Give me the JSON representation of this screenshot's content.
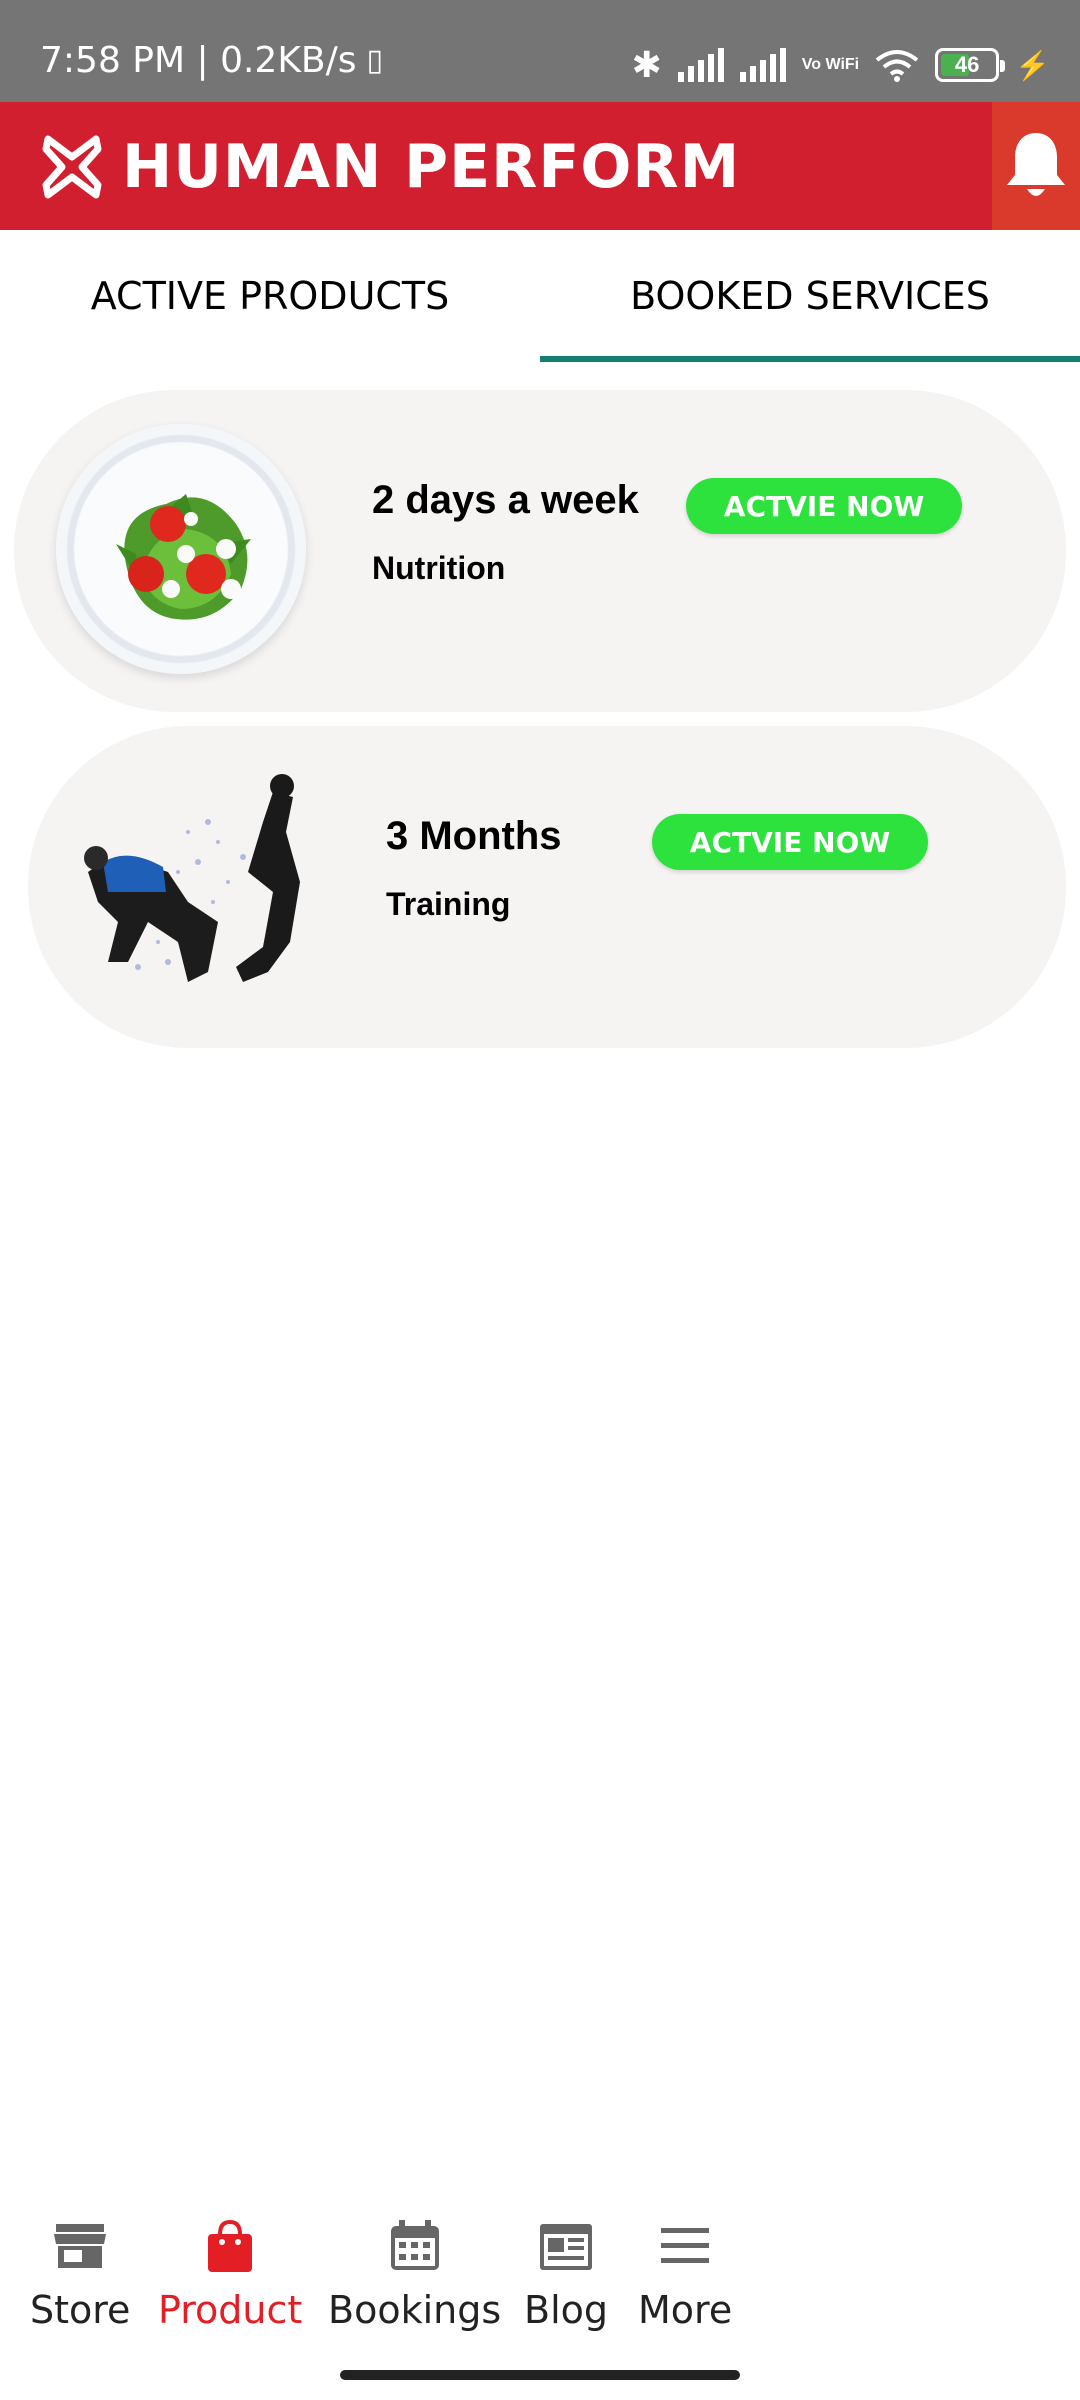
{
  "status_bar": {
    "time_speed": "7:58 PM | 0.2KB/s",
    "network_label": "Vo WiFi",
    "battery_level": "46",
    "icons": [
      "sim-icon",
      "bluetooth-icon",
      "signal-icon",
      "wifi-icon",
      "battery-icon",
      "charging-icon"
    ]
  },
  "header": {
    "brand_name": "HUMAN PERFORM",
    "brand_color": "#d21f2f",
    "notification_icon": "bell-icon"
  },
  "tabs": [
    {
      "label": "ACTIVE PRODUCTS",
      "active": false
    },
    {
      "label": "BOOKED SERVICES",
      "active": true
    }
  ],
  "tab_indicator_color": "#137f6f",
  "services": [
    {
      "title": "2 days a week",
      "category": "Nutrition",
      "button_label": "ACTVIE NOW",
      "image": "salad-plate"
    },
    {
      "title": "3 Months",
      "category": "Training",
      "button_label": "ACTVIE NOW",
      "image": "athletes-training"
    }
  ],
  "button_color": "#2de23d",
  "bottom_nav": [
    {
      "label": "Store",
      "icon": "store-icon",
      "active": false
    },
    {
      "label": "Product",
      "icon": "shopping-bag-icon",
      "active": true
    },
    {
      "label": "Bookings",
      "icon": "calendar-icon",
      "active": false
    },
    {
      "label": "Blog",
      "icon": "newspaper-icon",
      "active": false
    },
    {
      "label": "More",
      "icon": "menu-icon",
      "active": false
    }
  ],
  "active_nav_color": "#e31e24"
}
